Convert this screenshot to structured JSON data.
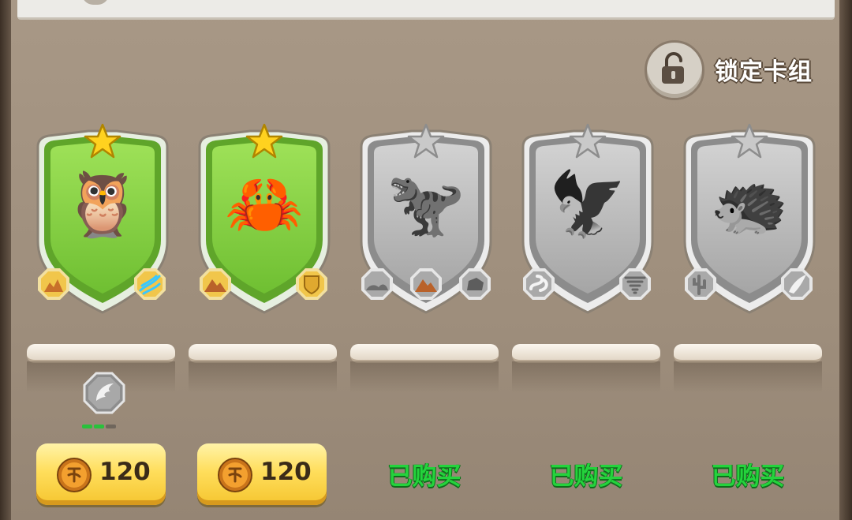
{
  "header": {
    "lock_label": "锁定卡组"
  },
  "cards": [
    {
      "name": "owl",
      "state": "active",
      "emoji": "🦉",
      "badges": [
        "desert-icon",
        "wind-icon"
      ]
    },
    {
      "name": "crab",
      "state": "active",
      "emoji": "🦀",
      "badges": [
        "mountain-icon",
        "shield-icon"
      ]
    },
    {
      "name": "dinosaur",
      "state": "locked",
      "emoji": "🦖",
      "badges": [
        "plain-icon",
        "mountain-icon",
        "rock-icon"
      ]
    },
    {
      "name": "pterodactyl",
      "state": "locked",
      "emoji": "🦅",
      "badges": [
        "snake-icon",
        "tornado-icon"
      ]
    },
    {
      "name": "shelled-beast",
      "state": "locked",
      "emoji": "🦔",
      "badges": [
        "cactus-icon",
        "horn-icon"
      ]
    }
  ],
  "upgrade": {
    "icon": "wing-gem-icon",
    "progress_filled": 2,
    "progress_total": 3
  },
  "actions": [
    {
      "type": "price",
      "value": "120"
    },
    {
      "type": "price",
      "value": "120"
    },
    {
      "type": "owned",
      "label": "已购买"
    },
    {
      "type": "owned",
      "label": "已购买"
    },
    {
      "type": "owned",
      "label": "已购买"
    }
  ],
  "colors": {
    "panel": "#a09080",
    "active_card": "#7fcf3a",
    "locked_card": "#b8b8b8",
    "star_gold": "#ffd21f",
    "owned_green": "#24d33c",
    "button_gold": "#ffde5c"
  }
}
